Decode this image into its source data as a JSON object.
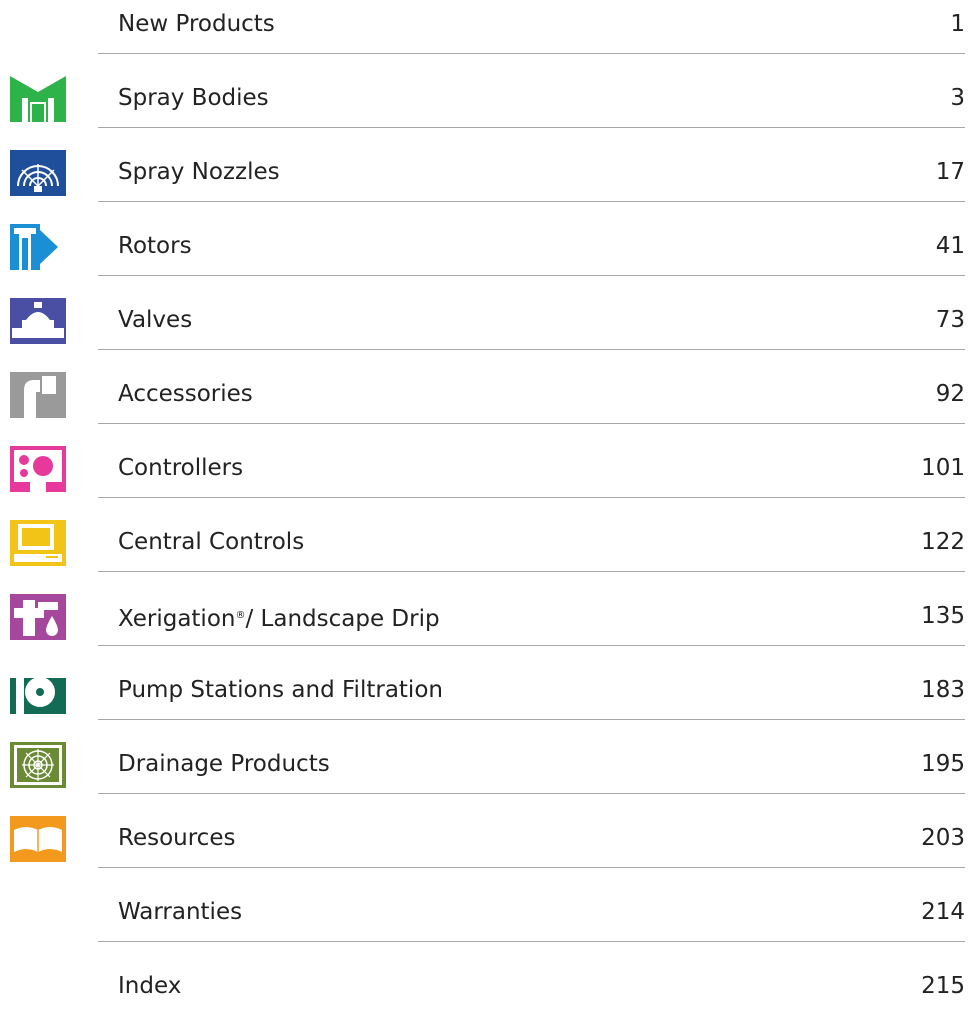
{
  "toc": {
    "entries": [
      {
        "label": "New Products",
        "page": "1",
        "icon": "",
        "color": ""
      },
      {
        "label": "Spray Bodies",
        "page": "3",
        "icon": "spray-body-icon",
        "color": "#2db34a"
      },
      {
        "label": "Spray Nozzles",
        "page": "17",
        "icon": "spray-nozzle-icon",
        "color": "#1f4f9a"
      },
      {
        "label": "Rotors",
        "page": "41",
        "icon": "rotor-icon",
        "color": "#1b8fd6"
      },
      {
        "label": "Valves",
        "page": "73",
        "icon": "valve-icon",
        "color": "#4b4fa3"
      },
      {
        "label": "Accessories",
        "page": "92",
        "icon": "elbow-fitting-icon",
        "color": "#9a9a9a"
      },
      {
        "label": "Controllers",
        "page": "101",
        "icon": "controller-icon",
        "color": "#e6399b"
      },
      {
        "label": "Central Controls",
        "page": "122",
        "icon": "computer-icon",
        "color": "#f2c418"
      },
      {
        "label": "Xerigation",
        "label_suffix": "/ Landscape Drip",
        "reg_mark": "®",
        "page": "135",
        "icon": "drip-icon",
        "color": "#a5479c"
      },
      {
        "label": "Pump Stations and Filtration",
        "page": "183",
        "icon": "pump-icon",
        "color": "#136a55"
      },
      {
        "label": "Drainage Products",
        "page": "195",
        "icon": "drain-grate-icon",
        "color": "#6b8a34"
      },
      {
        "label": "Resources",
        "page": "203",
        "icon": "book-icon",
        "color": "#f39a1e"
      },
      {
        "label": "Warranties",
        "page": "214",
        "icon": "",
        "color": ""
      },
      {
        "label": "Index",
        "page": "215",
        "icon": "",
        "color": ""
      }
    ]
  }
}
